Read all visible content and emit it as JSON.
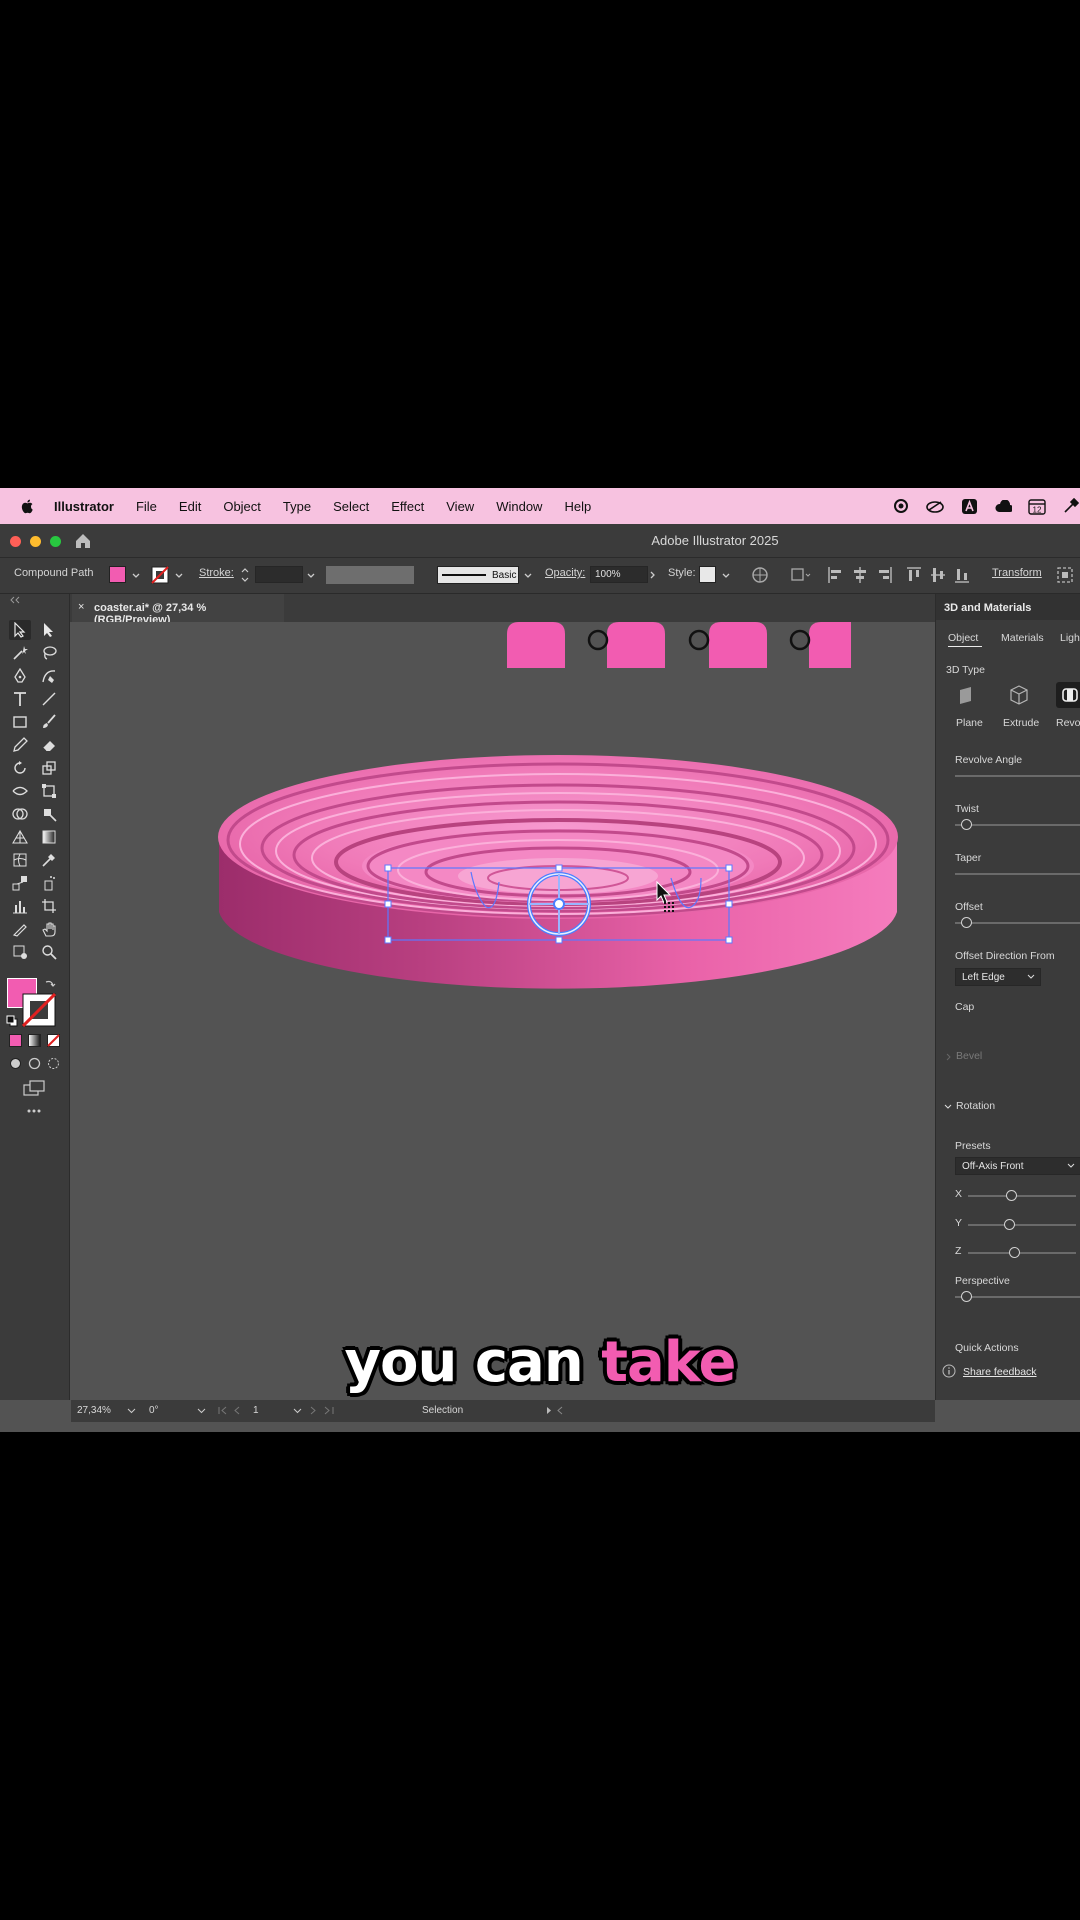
{
  "menubar": {
    "app": "Illustrator",
    "items": [
      "File",
      "Edit",
      "Object",
      "Type",
      "Select",
      "Effect",
      "View",
      "Window",
      "Help"
    ],
    "status_icons": [
      "record-icon",
      "creative-cloud-icon",
      "adobe-icon",
      "cloud-icon",
      "calendar-icon",
      "eyedropper-icon"
    ],
    "calendar_day": "12"
  },
  "titlebar": {
    "title": "Adobe Illustrator 2025"
  },
  "controlbar": {
    "selection_type": "Compound Path",
    "stroke_label": "Stroke:",
    "stroke_profile": "Basic",
    "opacity_label": "Opacity:",
    "opacity_value": "100%",
    "style_label": "Style:",
    "transform_label": "Transform"
  },
  "document": {
    "tab_title": "coaster.ai* @ 27,34 % (RGB/Preview)",
    "close": "×"
  },
  "panel": {
    "title": "3D and Materials",
    "tabs": [
      "Object",
      "Materials",
      "Ligh"
    ],
    "section_3d_type": "3D Type",
    "types": [
      "Plane",
      "Extrude",
      "Revol"
    ],
    "revolve_angle": "Revolve Angle",
    "twist": "Twist",
    "taper": "Taper",
    "offset": "Offset",
    "offset_direction_label": "Offset Direction From",
    "offset_direction_value": "Left Edge",
    "cap": "Cap",
    "bevel": "Bevel",
    "rotation": "Rotation",
    "presets_label": "Presets",
    "presets_value": "Off-Axis Front",
    "axis_x": "X",
    "axis_y": "Y",
    "axis_z": "Z",
    "perspective": "Perspective",
    "quick_actions": "Quick Actions",
    "share_feedback": "Share feedback"
  },
  "statusbar": {
    "zoom": "27,34%",
    "rotation": "0°",
    "artboard": "1",
    "tool": "Selection"
  },
  "caption": {
    "word1": "you can",
    "word2": "take"
  },
  "colors": {
    "fill": "#f25cb1",
    "menubar": "#f7c2e0",
    "accent": "#4a7fff"
  }
}
